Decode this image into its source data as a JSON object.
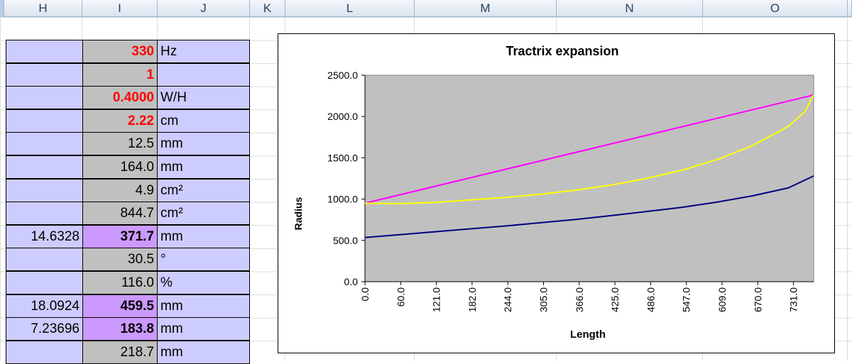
{
  "columns": [
    "H",
    "I",
    "J",
    "K",
    "L",
    "M",
    "N",
    "O"
  ],
  "rows": [
    {
      "h": "",
      "i": "330",
      "i_style": "red",
      "j": "Hz"
    },
    {
      "h": "",
      "i": "1",
      "i_style": "red",
      "j": ""
    },
    {
      "h": "",
      "i": "0.4000",
      "i_style": "red",
      "j": "W/H"
    },
    {
      "h": "",
      "i": "2.22",
      "i_style": "red",
      "j": "cm"
    },
    {
      "h": "",
      "i": "12.5",
      "i_style": "normal",
      "j": "mm"
    },
    {
      "h": "",
      "i": "164.0",
      "i_style": "normal",
      "j": "mm"
    },
    {
      "h": "",
      "i": "4.9",
      "i_style": "normal",
      "j": "cm²"
    },
    {
      "h": "",
      "i": "844.7",
      "i_style": "normal",
      "j": "cm²"
    },
    {
      "h": "14.6328",
      "i": "371.7",
      "i_style": "purple",
      "j": "mm"
    },
    {
      "h": "",
      "i": "30.5",
      "i_style": "normal",
      "j": "°"
    },
    {
      "h": "",
      "i": "116.0",
      "i_style": "normal",
      "j": "%"
    },
    {
      "h": "18.0924",
      "i": "459.5",
      "i_style": "purple",
      "j": "mm"
    },
    {
      "h": "7.23696",
      "i": "183.8",
      "i_style": "purple",
      "j": "mm"
    },
    {
      "h": "",
      "i": "218.7",
      "i_style": "normal",
      "j": "mm"
    }
  ],
  "chart_data": {
    "type": "line",
    "title": "Tractrix expansion",
    "xlabel": "Length",
    "ylabel": "Radius",
    "x_tick_labels": [
      "0.0",
      "60.0",
      "121.0",
      "182.0",
      "244.0",
      "305.0",
      "366.0",
      "425.0",
      "486.0",
      "547.0",
      "609.0",
      "670.0",
      "731.0"
    ],
    "xlim": [
      0,
      775
    ],
    "ylim": [
      0,
      2500
    ],
    "y_ticks": [
      "0.0",
      "500.0",
      "1000.0",
      "1500.0",
      "2000.0",
      "2500.0"
    ],
    "plot_background": "#c0c0c0",
    "series": [
      {
        "color": "#ff00ff",
        "x": [
          0,
          775
        ],
        "y": [
          950,
          2260
        ]
      },
      {
        "color": "#ffff00",
        "x": [
          0,
          60,
          121,
          182,
          244,
          305,
          366,
          425,
          486,
          547,
          609,
          670,
          731,
          760,
          775
        ],
        "y": [
          950,
          945,
          960,
          990,
          1020,
          1060,
          1110,
          1170,
          1250,
          1350,
          1480,
          1650,
          1880,
          2060,
          2260
        ]
      },
      {
        "color": "#000080",
        "x": [
          0,
          60,
          121,
          182,
          244,
          305,
          366,
          425,
          486,
          547,
          609,
          670,
          731,
          775
        ],
        "y": [
          535,
          570,
          605,
          640,
          675,
          715,
          755,
          800,
          850,
          900,
          965,
          1040,
          1135,
          1280
        ]
      }
    ]
  }
}
